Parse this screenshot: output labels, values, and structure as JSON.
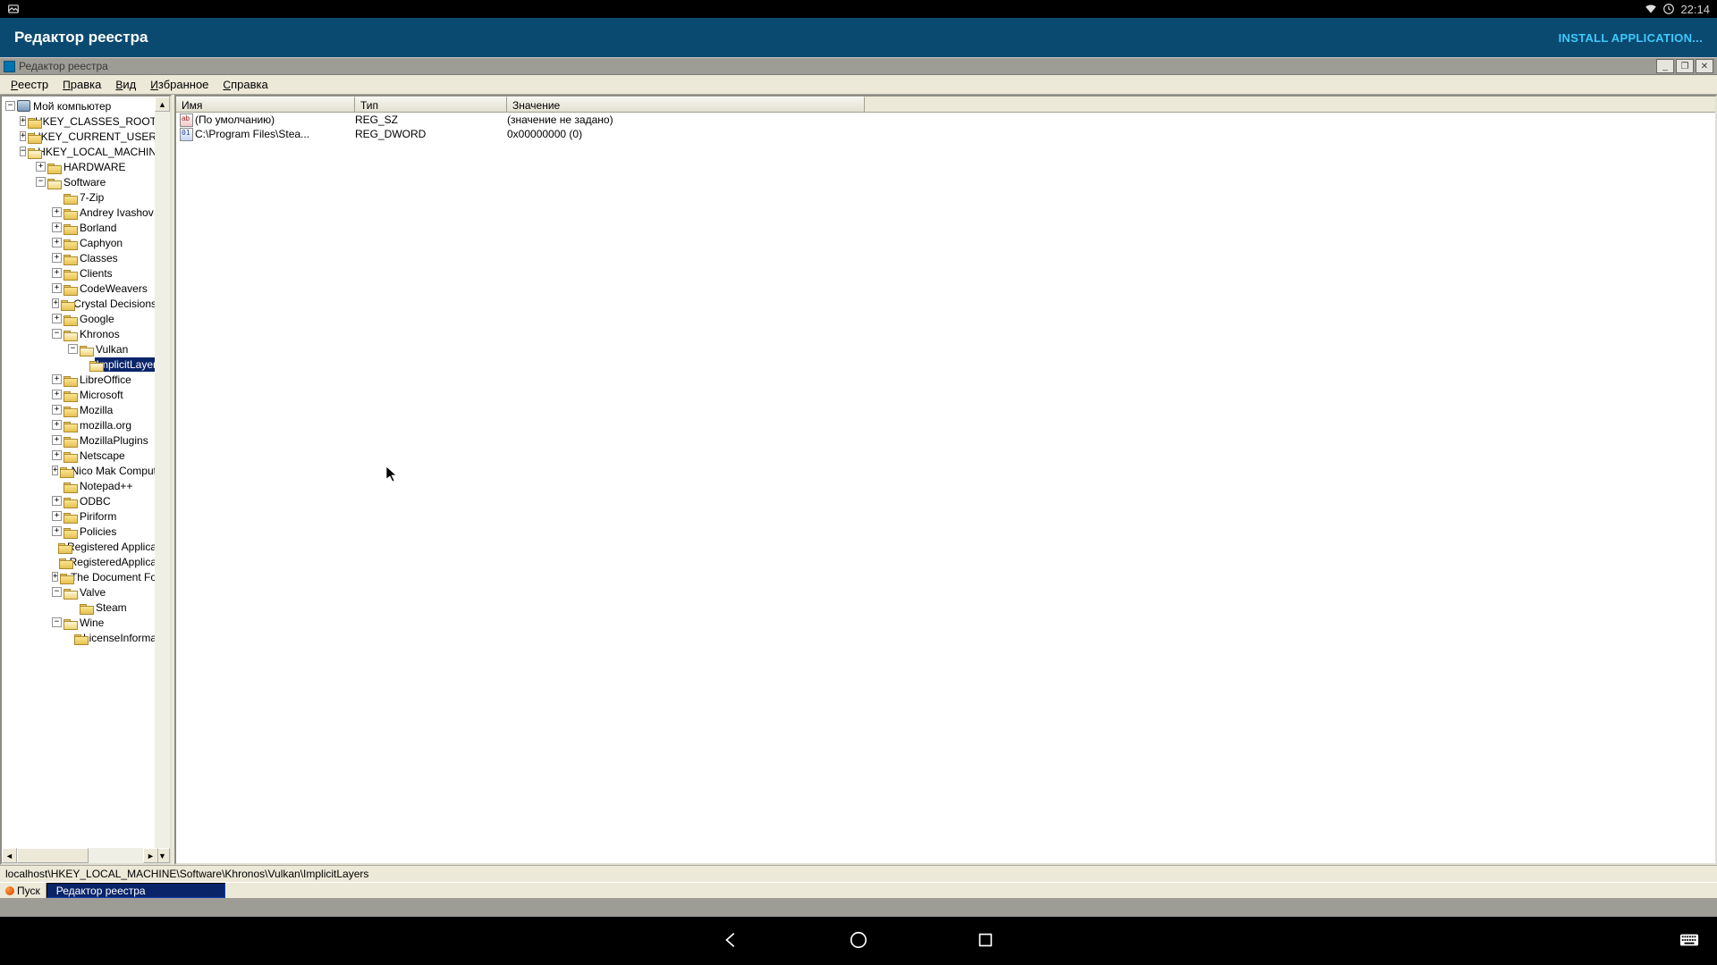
{
  "android_status": {
    "time": "22:14"
  },
  "app_titlebar": {
    "title": "Редактор реестра",
    "install": "INSTALL APPLICATION..."
  },
  "win_title": "Редактор реестра",
  "menu": [
    "Реестр",
    "Правка",
    "Вид",
    "Избранное",
    "Справка"
  ],
  "tree": {
    "root": "Мой компьютер",
    "hkcr": "HKEY_CLASSES_ROOT",
    "hkcu": "HKEY_CURRENT_USER",
    "hklm": "HKEY_LOCAL_MACHIN",
    "hardware": "HARDWARE",
    "software": "Software",
    "items": [
      {
        "exp": false,
        "label": "7-Zip"
      },
      {
        "exp": true,
        "label": "Andrey Ivashov"
      },
      {
        "exp": true,
        "label": "Borland"
      },
      {
        "exp": true,
        "label": "Caphyon"
      },
      {
        "exp": true,
        "label": "Classes"
      },
      {
        "exp": true,
        "label": "Clients"
      },
      {
        "exp": true,
        "label": "CodeWeavers"
      },
      {
        "exp": true,
        "label": "Crystal Decisions"
      },
      {
        "exp": true,
        "label": "Google"
      }
    ],
    "khronos": "Khronos",
    "vulkan": "Vulkan",
    "implicit": "ImplicitLayer",
    "items2": [
      {
        "exp": true,
        "label": "LibreOffice"
      },
      {
        "exp": true,
        "label": "Microsoft"
      },
      {
        "exp": true,
        "label": "Mozilla"
      },
      {
        "exp": true,
        "label": "mozilla.org"
      },
      {
        "exp": true,
        "label": "MozillaPlugins"
      },
      {
        "exp": true,
        "label": "Netscape"
      },
      {
        "exp": true,
        "label": "Nico Mak Comput"
      },
      {
        "exp": false,
        "label": "Notepad++"
      },
      {
        "exp": true,
        "label": "ODBC"
      },
      {
        "exp": true,
        "label": "Piriform"
      },
      {
        "exp": true,
        "label": "Policies"
      },
      {
        "exp": false,
        "label": "Registered Applica"
      },
      {
        "exp": false,
        "label": "RegisteredApplica"
      },
      {
        "exp": true,
        "label": "The Document Fo"
      },
      {
        "exp": true,
        "label": "Valve"
      }
    ],
    "steam": "Steam",
    "wine": "Wine",
    "licenseinfo": "LicenseInforma"
  },
  "columns": {
    "name": "Имя",
    "type": "Тип",
    "value": "Значение"
  },
  "values": [
    {
      "icon": "sz",
      "name": "(По умолчанию)",
      "type": "REG_SZ",
      "value": "(значение не задано)"
    },
    {
      "icon": "dw",
      "name": "C:\\Program Files\\Stea...",
      "type": "REG_DWORD",
      "value": "0x00000000 (0)"
    }
  ],
  "statusbar": "localhost\\HKEY_LOCAL_MACHINE\\Software\\Khronos\\Vulkan\\ImplicitLayers",
  "taskbar": {
    "start": "Пуск",
    "task": "Редактор реестра"
  }
}
